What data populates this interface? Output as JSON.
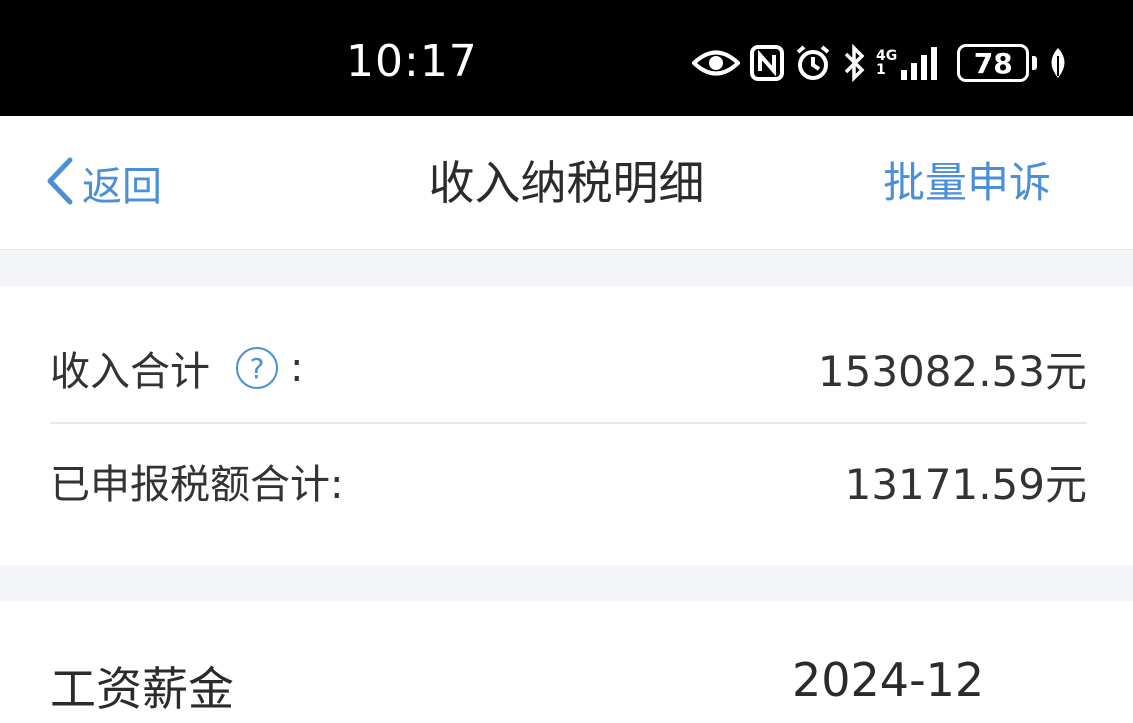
{
  "status_bar": {
    "time": "10:17",
    "network": "4G",
    "network_sub": "1",
    "battery_level": "78",
    "icons": [
      "eye-icon",
      "nfc-icon",
      "alarm-icon",
      "bluetooth-icon",
      "signal-icon",
      "battery-icon",
      "leaf-icon"
    ]
  },
  "nav": {
    "back_label": "返回",
    "title": "收入纳税明细",
    "action_label": "批量申诉",
    "accent_color": "#4a8fd8"
  },
  "summary": {
    "income_total_label": "收入合计",
    "income_total_colon": ":",
    "income_total_value": "153082.53元",
    "help_icon_text": "?",
    "declared_tax_label": "已申报税额合计:",
    "declared_tax_value": "13171.59元"
  },
  "income_item": {
    "type": "工资薪金",
    "period": "2024-12"
  }
}
